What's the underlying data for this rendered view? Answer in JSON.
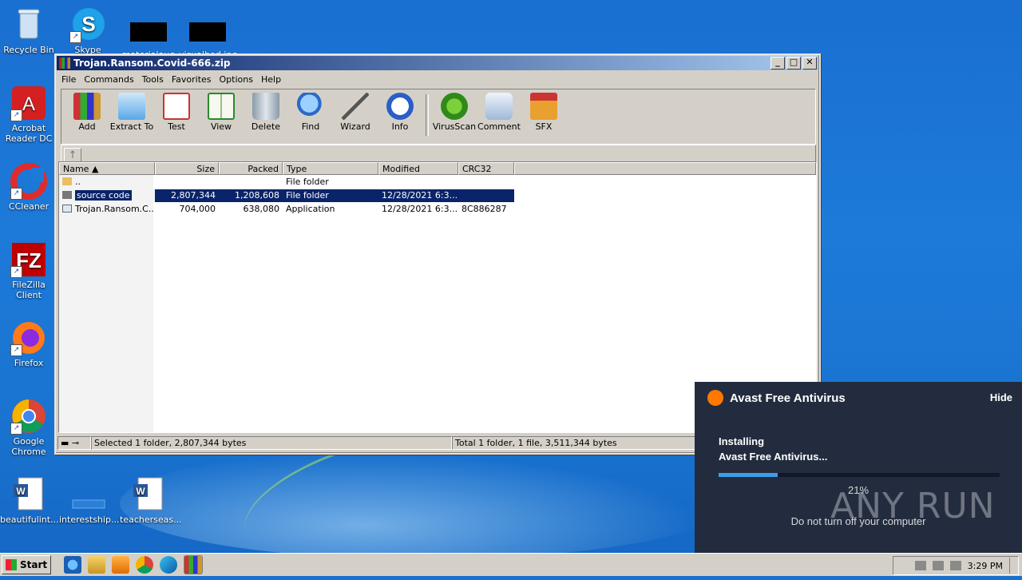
{
  "desktop": {
    "icons": [
      {
        "label": "Recycle Bin"
      },
      {
        "label": "Skype"
      },
      {
        "label": "materialaug"
      },
      {
        "label": "visualbed.jpg"
      },
      {
        "label": "Acrobat Reader DC"
      },
      {
        "label": "CCleaner"
      },
      {
        "label": "FileZilla Client"
      },
      {
        "label": "Firefox"
      },
      {
        "label": "Google Chrome"
      },
      {
        "label": "beautifulint..."
      },
      {
        "label": "interestship..."
      },
      {
        "label": "teacherseas..."
      }
    ]
  },
  "window": {
    "title": "Trojan.Ransom.Covid-666.zip",
    "menu": [
      "File",
      "Commands",
      "Tools",
      "Favorites",
      "Options",
      "Help"
    ],
    "toolbar": [
      "Add",
      "Extract To",
      "Test",
      "View",
      "Delete",
      "Find",
      "Wizard",
      "Info",
      "VirusScan",
      "Comment",
      "SFX"
    ],
    "columns": [
      "Name",
      "Size",
      "Packed",
      "Type",
      "Modified",
      "CRC32"
    ],
    "rows": [
      {
        "name": "..",
        "size": "",
        "packed": "",
        "type": "File folder",
        "modified": "",
        "crc": ""
      },
      {
        "name": "source code",
        "size": "2,807,344",
        "packed": "1,208,608",
        "type": "File folder",
        "modified": "12/28/2021 6:3...",
        "crc": ""
      },
      {
        "name": "Trojan.Ransom.C...",
        "size": "704,000",
        "packed": "638,080",
        "type": "Application",
        "modified": "12/28/2021 6:3...",
        "crc": "8C886287"
      }
    ],
    "status_left": "Selected 1 folder, 2,807,344 bytes",
    "status_right": "Total 1 folder, 1 file, 3,511,344 bytes"
  },
  "avast": {
    "title": "Avast Free Antivirus",
    "hide": "Hide",
    "line1": "Installing",
    "line2": "Avast Free Antivirus...",
    "progress": 0.21,
    "percent": "21%",
    "note": "Do not turn off your computer",
    "watermark": "ANY RUN"
  },
  "taskbar": {
    "start": "Start",
    "clock": "3:29 PM"
  },
  "colors": {
    "desktop": "#1a74d1",
    "selection": "#0a246a",
    "avast_bg": "#232c3f",
    "avast_accent": "#ff7800",
    "progress": "#3a9ee8"
  }
}
